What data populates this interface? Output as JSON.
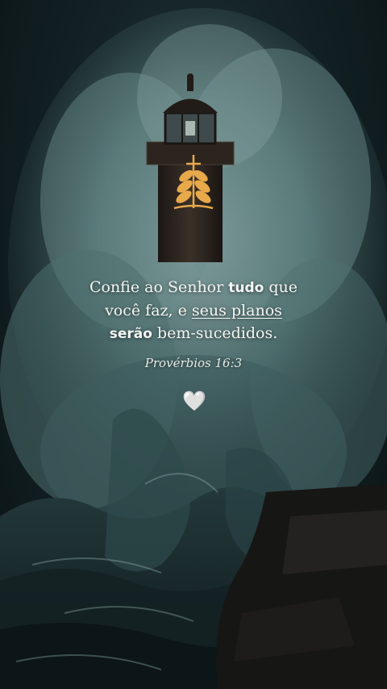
{
  "verse": {
    "part1": "Confie ao Senhor ",
    "bold1": "tudo",
    "part2": " que",
    "line2_start": "você faz, e ",
    "underlined": "seus planos",
    "bold2": "serão",
    "part3": " bem-sucedidos."
  },
  "reference": "Provérbios 16:3",
  "heart_glyph": "🤍",
  "icons": {
    "logo": "wheat-cross-logo-icon",
    "heart": "white-heart-icon"
  },
  "colors": {
    "logo": "#e8a94a",
    "text": "#f3f5f2",
    "wave": "#5d7f80",
    "lighthouse": "#2a2420"
  }
}
